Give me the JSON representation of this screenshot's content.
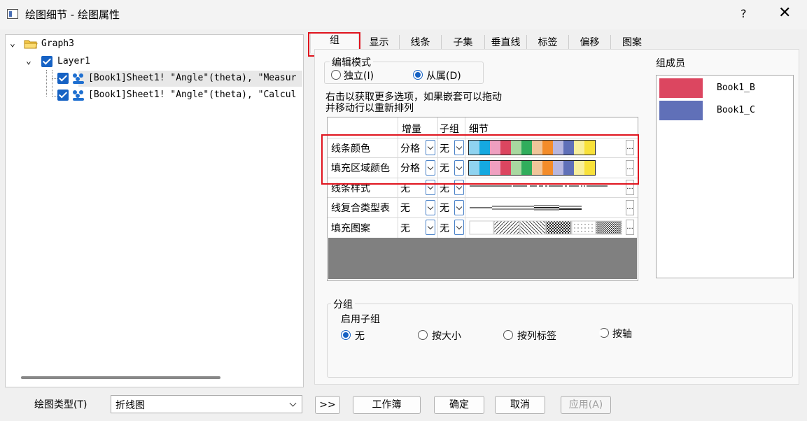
{
  "window": {
    "title": "绘图细节 - 绘图属性",
    "help": "?",
    "close": "✕"
  },
  "tree": {
    "graph": "Graph3",
    "layer": "Layer1",
    "items": [
      "[Book1]Sheet1! \"Angle\"(theta), \"Measur",
      "[Book1]Sheet1! \"Angle\"(theta), \"Calcul"
    ]
  },
  "tabs": [
    "组",
    "显示",
    "线条",
    "子集",
    "垂直线",
    "标签",
    "偏移",
    "图案"
  ],
  "edit_mode": {
    "legend": "编辑模式",
    "options": [
      "独立(I)",
      "从属(D)"
    ],
    "selected": "从属(D)"
  },
  "hint": [
    "右击以获取更多选项，如果嵌套可以拖动",
    "并移动行以重新排列"
  ],
  "grid": {
    "headers": [
      "增量",
      "子组",
      "细节"
    ],
    "rows": [
      {
        "label": "线条颜色",
        "increment": "分格",
        "subgroup": "无"
      },
      {
        "label": "填充区域颜色",
        "increment": "分格",
        "subgroup": "无"
      },
      {
        "label": "线条样式",
        "increment": "无",
        "subgroup": "无"
      },
      {
        "label": "线复合类型表",
        "increment": "无",
        "subgroup": "无"
      },
      {
        "label": "填充图案",
        "increment": "无",
        "subgroup": "无"
      }
    ],
    "ellipsis": "...",
    "palette": [
      "#8fd3f0",
      "#15a9e0",
      "#ef9fc0",
      "#dc4660",
      "#a8d8a0",
      "#31ad5c",
      "#f0c59a",
      "#f38c2a",
      "#b7b7e0",
      "#6070b8",
      "#f8ef9c",
      "#f8e13a"
    ]
  },
  "group_members": {
    "label": "组成员",
    "items": [
      {
        "name": "Book1_B",
        "color": "#dc4660"
      },
      {
        "name": "Book1_C",
        "color": "#6070b8"
      }
    ]
  },
  "subgroup": {
    "legend": "分组",
    "enable_label": "启用子组",
    "options": [
      "无",
      "按大小",
      "按列标签",
      "按轴"
    ],
    "selected": "无"
  },
  "bottom": {
    "plot_type_label": "绘图类型(T)",
    "plot_type_value": "折线图",
    "expand": ">>",
    "workbook": "工作簿",
    "ok": "确定",
    "cancel": "取消",
    "apply": "应用(A)"
  }
}
